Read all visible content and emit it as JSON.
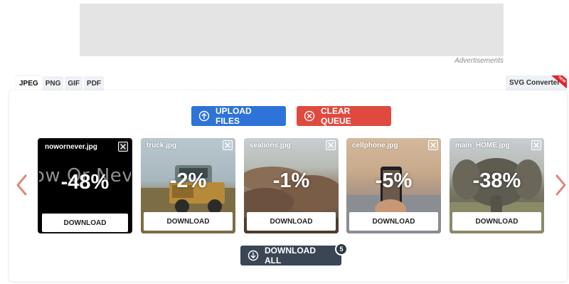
{
  "ads": {
    "label": "Advertisements"
  },
  "tabs": [
    {
      "label": "JPEG",
      "active": true
    },
    {
      "label": "PNG",
      "active": false
    },
    {
      "label": "GIF",
      "active": false
    },
    {
      "label": "PDF",
      "active": false
    }
  ],
  "svg_tab": {
    "label": "SVG Converter",
    "ribbon": "NEW"
  },
  "toolbar": {
    "upload_label": "UPLOAD FILES",
    "clear_label": "CLEAR QUEUE"
  },
  "files": [
    {
      "name": "nowornever.jpg",
      "percent": "-48%",
      "download_label": "DOWNLOAD",
      "bg_text": "ow Or Never"
    },
    {
      "name": "truck.jpg",
      "percent": "-2%",
      "download_label": "DOWNLOAD"
    },
    {
      "name": "sealions.jpg",
      "percent": "-1%",
      "download_label": "DOWNLOAD"
    },
    {
      "name": "cellphone.jpg",
      "percent": "-5%",
      "download_label": "DOWNLOAD"
    },
    {
      "name": "main_HOME.jpg",
      "percent": "-38%",
      "download_label": "DOWNLOAD"
    }
  ],
  "download_all": {
    "label": "DOWNLOAD ALL",
    "count": "5"
  },
  "colors": {
    "upload": "#2e73d8",
    "clear": "#e04a3e",
    "download_all": "#3b4654",
    "arrow": "#e0867e"
  }
}
